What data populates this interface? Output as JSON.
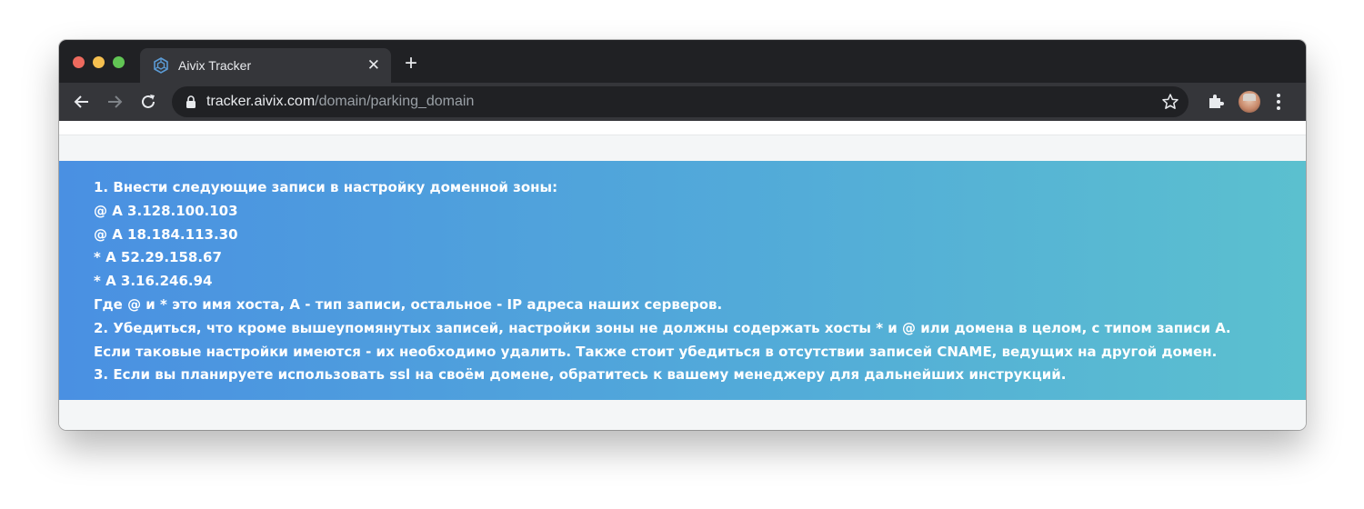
{
  "browser": {
    "tab": {
      "title": "Aivix Tracker",
      "close_symbol": "✕",
      "favicon": "aivix-logo-icon"
    },
    "new_tab_symbol": "+",
    "address_bar": {
      "host": "tracker.aivix.com",
      "path": "/domain/parking_domain"
    },
    "icons": {
      "back": "back-arrow-icon",
      "forward": "forward-arrow-icon",
      "reload": "reload-icon",
      "lock": "lock-icon",
      "bookmark": "star-icon",
      "extensions": "puzzle-icon",
      "menu": "kebab-menu-icon"
    }
  },
  "instructions": {
    "lines": [
      "1. Внести следующие записи в настройку доменной зоны:",
      "@ A 3.128.100.103",
      "@ A 18.184.113.30",
      "* A 52.29.158.67",
      "* A 3.16.246.94",
      "Где @ и * это имя хоста, А - тип записи, остальное - IP адреса наших серверов.",
      "2. Убедиться, что кроме вышеупомянутых записей, настройки зоны не должны содержать хосты * и @ или домена в целом, с типом записи А.",
      "Если таковые настройки имеются - их необходимо удалить. Также стоит убедиться в отсутствии записей CNAME, ведущих на другой домен.",
      "3. Если вы планируете использовать ssl на своём домене, обратитесь к вашему менеджеру для дальнейших инструкций."
    ]
  },
  "colors": {
    "banner_start": "#4a90e2",
    "banner_end": "#5bc0cf",
    "chrome_dark": "#202124",
    "chrome_toolbar": "#35363a"
  }
}
